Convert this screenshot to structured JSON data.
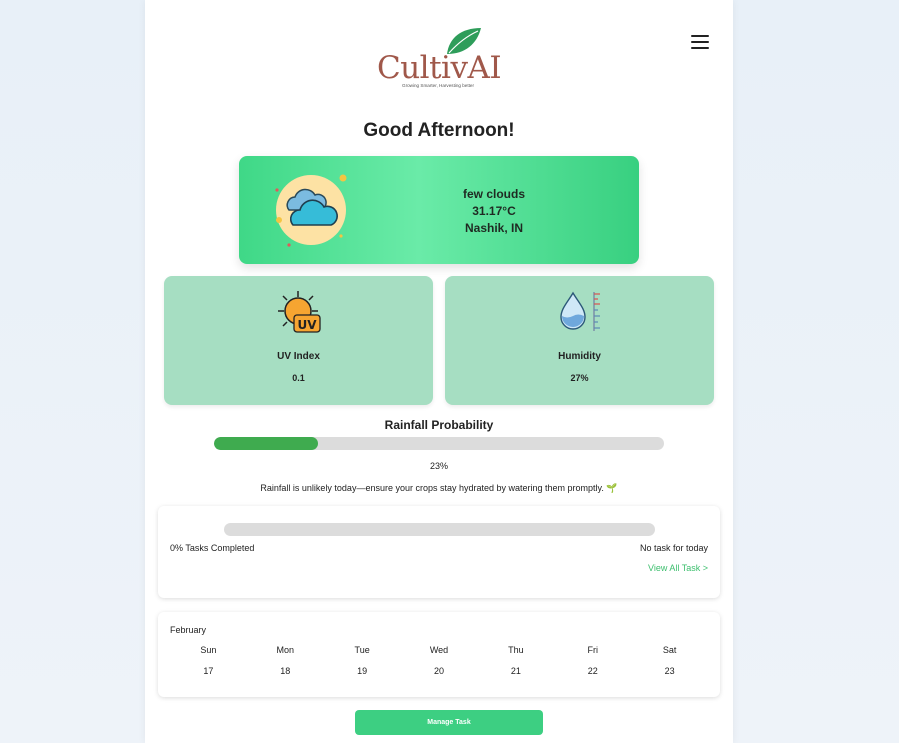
{
  "brand": {
    "name": "CultivAI",
    "tagline": "Growing Smarter, Harvesting better",
    "primary_color": "#a0584a",
    "leaf_color": "#2e9d5a"
  },
  "header": {
    "menu_icon": "hamburger-menu-icon"
  },
  "greeting": "Good Afternoon!",
  "weather": {
    "icon": "cloudy-sun-icon",
    "description": "few clouds",
    "temperature": "31.17°C",
    "location": "Nashik, IN"
  },
  "stats": {
    "uv": {
      "icon": "uv-sun-icon",
      "label": "UV Index",
      "value": "0.1"
    },
    "humidity": {
      "icon": "humidity-drop-icon",
      "label": "Humidity",
      "value": "27%"
    }
  },
  "rainfall": {
    "title": "Rainfall Probability",
    "value_fraction": 0.23,
    "percent_label": "23%",
    "message": "Rainfall is unlikely today—ensure your crops stay hydrated by watering them promptly. 🌱"
  },
  "tasks": {
    "completed_fraction": 0,
    "completed_label": "0% Tasks Completed",
    "status": "No task for today",
    "view_all": "View All Task >"
  },
  "calendar": {
    "month": "February",
    "days": [
      {
        "name": "Sun",
        "date": "17"
      },
      {
        "name": "Mon",
        "date": "18"
      },
      {
        "name": "Tue",
        "date": "19"
      },
      {
        "name": "Wed",
        "date": "20"
      },
      {
        "name": "Thu",
        "date": "21"
      },
      {
        "name": "Fri",
        "date": "22"
      },
      {
        "name": "Sat",
        "date": "23"
      }
    ]
  },
  "manage_button": "Manage Task",
  "colors": {
    "accent_green": "#3dcf82",
    "progress_green": "#3fab4f",
    "stat_card_bg": "#a6dec2"
  }
}
